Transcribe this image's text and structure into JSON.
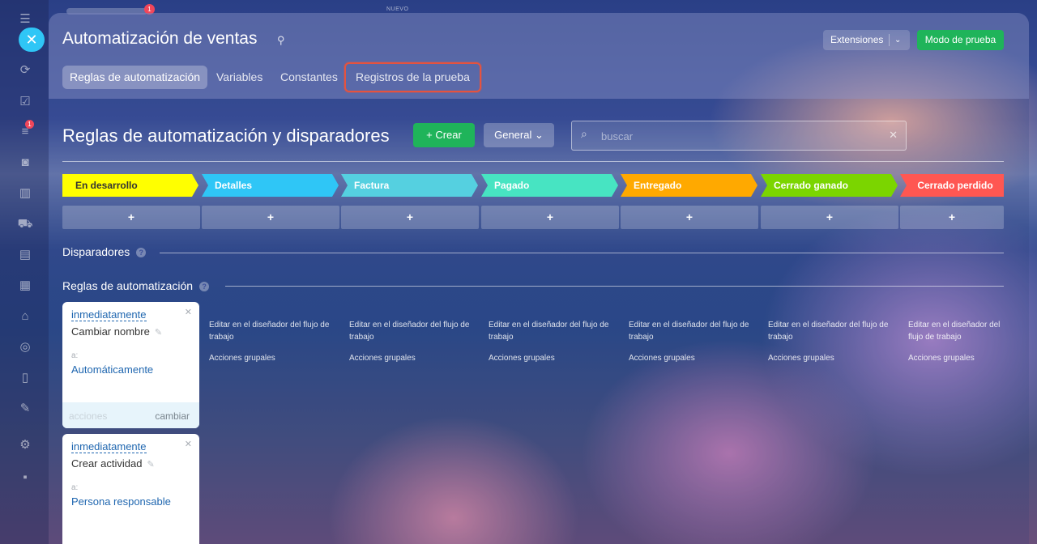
{
  "top": {
    "nuevo": "NUEVO",
    "badge": "1"
  },
  "sidebar": {
    "badge": "1"
  },
  "header": {
    "title": "Automatización de ventas",
    "extensions": "Extensiones",
    "test_mode": "Modo de prueba",
    "tabs": [
      "Reglas de automatización",
      "Variables",
      "Constantes",
      "Registros de la prueba"
    ]
  },
  "toolbar": {
    "heading": "Reglas de automatización y disparadores",
    "create": "+ Crear",
    "general": "General",
    "search_placeholder": "buscar"
  },
  "stages": [
    {
      "label": "En desarrollo",
      "color": "#ffff00",
      "text_color": "#333333"
    },
    {
      "label": "Detalles",
      "color": "#2fc6f6",
      "text_color": "#ffffff"
    },
    {
      "label": "Factura",
      "color": "#55d0e0",
      "text_color": "#ffffff"
    },
    {
      "label": "Pagado",
      "color": "#47e4c2",
      "text_color": "#ffffff"
    },
    {
      "label": "Entregado",
      "color": "#ffa900",
      "text_color": "#ffffff"
    },
    {
      "label": "Cerrado ganado",
      "color": "#7bd500",
      "text_color": "#ffffff"
    },
    {
      "label": "Cerrado perdido",
      "color": "#ff5752",
      "text_color": "#ffffff"
    }
  ],
  "add_symbol": "+",
  "sections": {
    "triggers": "Disparadores",
    "rules": "Reglas de automatización",
    "help": "?"
  },
  "cards": [
    {
      "when": "inmediatamente",
      "name": "Cambiar nombre",
      "a": "a:",
      "target": "Automáticamente",
      "actions": "acciones",
      "change": "cambiar"
    },
    {
      "when": "inmediatamente",
      "name": "Crear actividad",
      "a": "a:",
      "target": "Persona responsable"
    }
  ],
  "columns": {
    "edit_link": "Editar en el diseñador del flujo de trabajo",
    "group_actions": "Acciones grupales"
  }
}
